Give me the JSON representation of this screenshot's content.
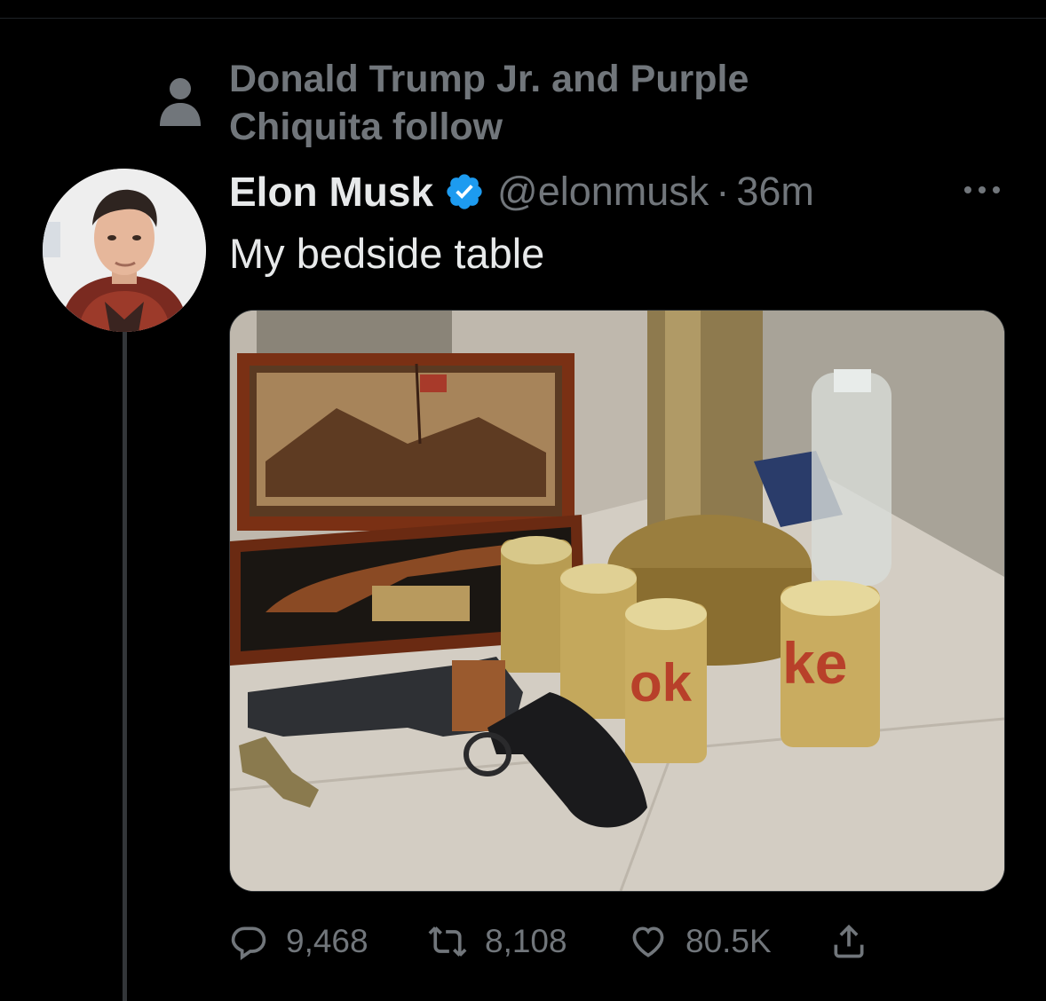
{
  "social_context": {
    "text": "Donald Trump Jr. and Purple Chiquita  follow"
  },
  "tweet": {
    "author_name": "Elon Musk",
    "handle": "@elonmusk",
    "separator": "·",
    "time": "36m",
    "text": "My bedside table"
  },
  "actions": {
    "replies": "9,468",
    "retweets": "8,108",
    "likes": "80.5K"
  },
  "icons": [
    "person-icon",
    "verified-badge-icon",
    "more-icon",
    "reply-icon",
    "retweet-icon",
    "like-icon",
    "share-icon"
  ],
  "colors": {
    "background": "#000000",
    "text": "#e7e9ea",
    "secondary": "#71767b",
    "verified": "#1d9bf0"
  }
}
